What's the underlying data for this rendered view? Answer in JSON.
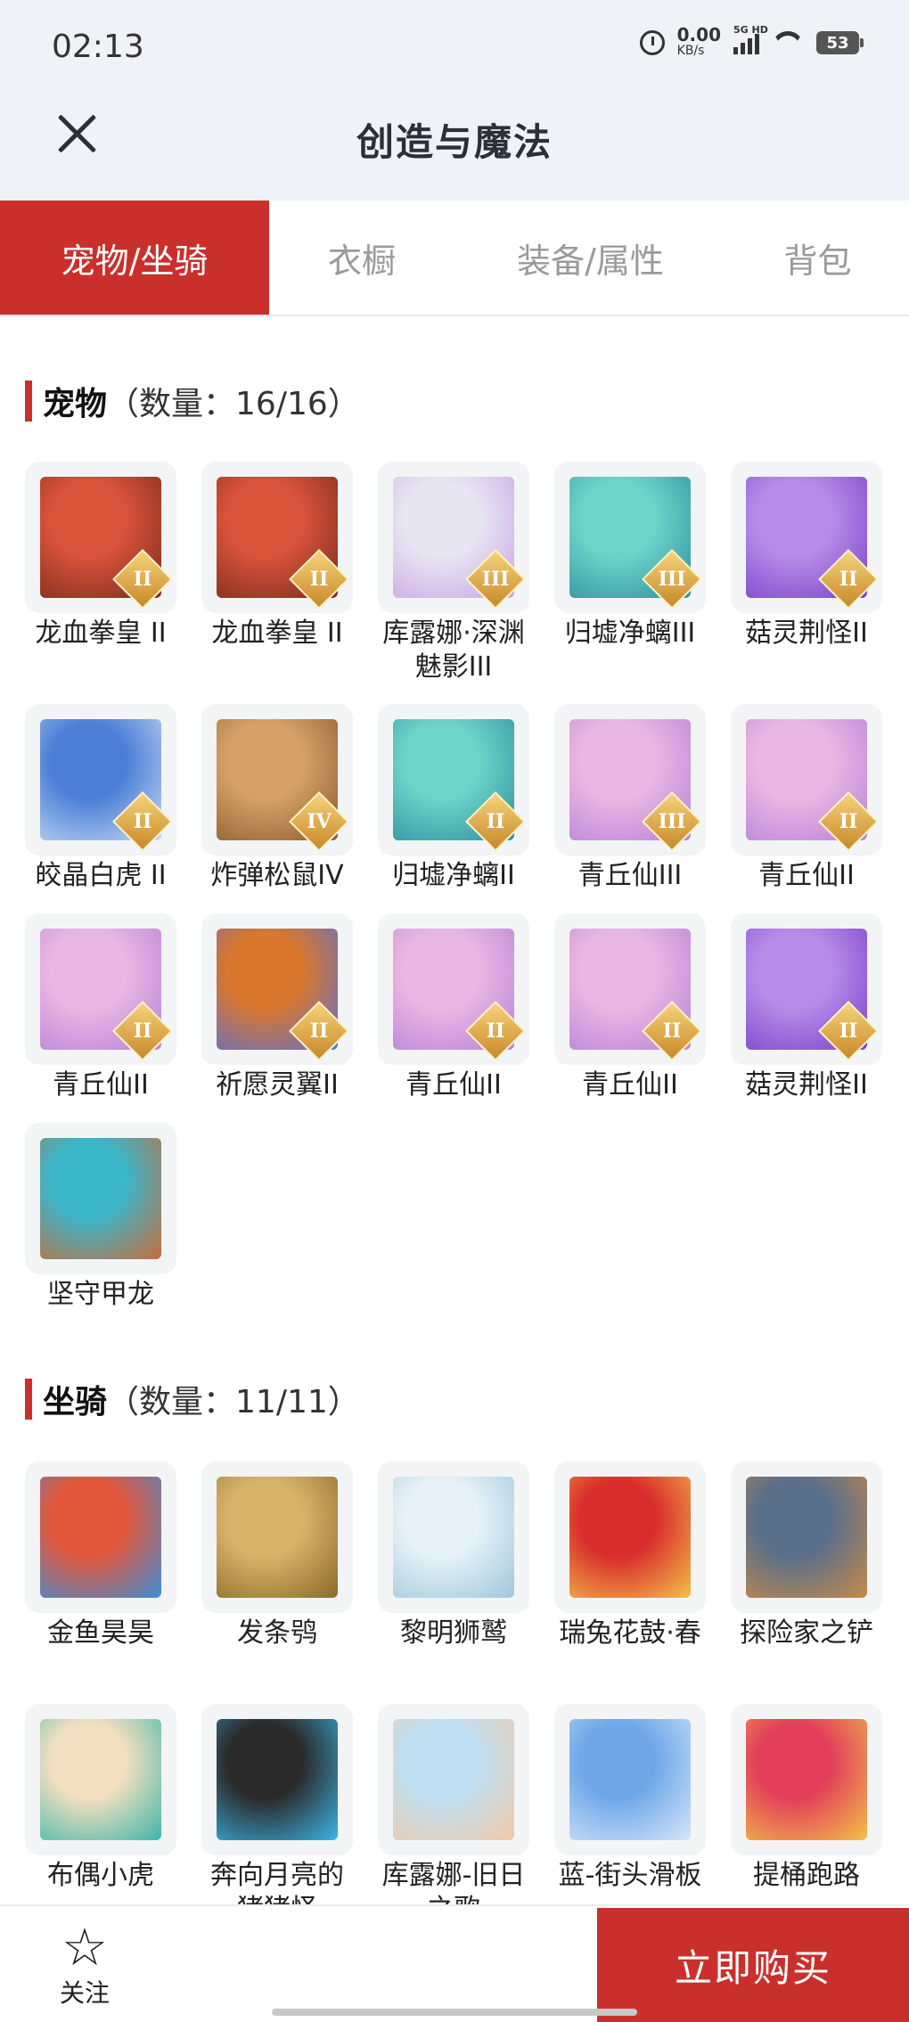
{
  "status": {
    "time": "02:13",
    "speed_value": "0.00",
    "speed_unit": "KB/s",
    "network": "5G HD",
    "battery": "53"
  },
  "header": {
    "title": "创造与魔法"
  },
  "tabs": [
    {
      "label": "宠物/坐骑",
      "active": true
    },
    {
      "label": "衣橱",
      "active": false
    },
    {
      "label": "装备/属性",
      "active": false
    },
    {
      "label": "背包",
      "active": false
    }
  ],
  "pets": {
    "title": "宠物",
    "count": "（数量：16/16）",
    "items": [
      {
        "name": "龙血拳皇 II",
        "rank": "II",
        "colors": [
          "#d9533a",
          "#7a2a1e"
        ],
        "icon": "dragon-fist-emperor-icon"
      },
      {
        "name": "龙血拳皇 II",
        "rank": "II",
        "colors": [
          "#d9533a",
          "#7a2a1e"
        ],
        "icon": "dragon-fist-emperor-icon"
      },
      {
        "name": "库露娜·深渊魅影III",
        "rank": "III",
        "colors": [
          "#e8e6f2",
          "#c8a3e6"
        ],
        "icon": "kuluna-abyss-icon"
      },
      {
        "name": "归墟净螭III",
        "rank": "III",
        "colors": [
          "#6fd3c9",
          "#2a8f9e"
        ],
        "icon": "guixu-dragon-icon"
      },
      {
        "name": "菇灵荆怪II",
        "rank": "II",
        "colors": [
          "#b78ce8",
          "#7a3fc9"
        ],
        "icon": "mushroom-sprite-icon"
      },
      {
        "name": "皎晶白虎 II",
        "rank": "II",
        "colors": [
          "#4b7fd6",
          "#c9dbf4"
        ],
        "icon": "white-tiger-icon"
      },
      {
        "name": "炸弹松鼠IV",
        "rank": "IV",
        "colors": [
          "#d6a26a",
          "#8a5a2a"
        ],
        "icon": "bomb-squirrel-icon"
      },
      {
        "name": "归墟净螭II",
        "rank": "II",
        "colors": [
          "#6fd3c9",
          "#2a8f9e"
        ],
        "icon": "guixu-dragon-icon"
      },
      {
        "name": "青丘仙III",
        "rank": "III",
        "colors": [
          "#eab7e4",
          "#b681d6"
        ],
        "icon": "qingqiu-fairy-icon"
      },
      {
        "name": "青丘仙II",
        "rank": "II",
        "colors": [
          "#eab7e4",
          "#b681d6"
        ],
        "icon": "qingqiu-fairy-icon"
      },
      {
        "name": "青丘仙II",
        "rank": "II",
        "colors": [
          "#eab7e4",
          "#b681d6"
        ],
        "icon": "qingqiu-fairy-icon"
      },
      {
        "name": "祈愿灵翼II",
        "rank": "II",
        "colors": [
          "#d9772e",
          "#5a6fd0"
        ],
        "icon": "wish-wing-icon"
      },
      {
        "name": "青丘仙II",
        "rank": "II",
        "colors": [
          "#eab7e4",
          "#b681d6"
        ],
        "icon": "qingqiu-fairy-icon"
      },
      {
        "name": "青丘仙II",
        "rank": "II",
        "colors": [
          "#eab7e4",
          "#b681d6"
        ],
        "icon": "qingqiu-fairy-icon"
      },
      {
        "name": "菇灵荆怪II",
        "rank": "II",
        "colors": [
          "#b78ce8",
          "#7a3fc9"
        ],
        "icon": "mushroom-sprite-icon"
      },
      {
        "name": "坚守甲龙",
        "rank": "",
        "colors": [
          "#3bb6c9",
          "#c96b3a"
        ],
        "icon": "armored-dragon-icon"
      }
    ]
  },
  "mounts": {
    "title": "坐骑",
    "count": "（数量：11/11）",
    "items": [
      {
        "name": "金鱼昊昊",
        "rank": "",
        "colors": [
          "#e2573c",
          "#3c8fd6"
        ],
        "icon": "goldfish-icon"
      },
      {
        "name": "发条鸮",
        "rank": "",
        "colors": [
          "#d8b46a",
          "#8a6a2a"
        ],
        "icon": "clockwork-owl-icon"
      },
      {
        "name": "黎明狮鹫",
        "rank": "",
        "colors": [
          "#e6f2f8",
          "#9fc7da"
        ],
        "icon": "dawn-griffin-icon"
      },
      {
        "name": "瑞兔花鼓·春",
        "rank": "",
        "colors": [
          "#d92c2c",
          "#f2c24a"
        ],
        "icon": "rabbit-drum-icon"
      },
      {
        "name": "探险家之铲",
        "rank": "",
        "colors": [
          "#5a6f8a",
          "#c88a4a"
        ],
        "icon": "explorer-shovel-icon"
      },
      {
        "name": "布偶小虎",
        "rank": "",
        "colors": [
          "#f2dfc0",
          "#3bb6a8"
        ],
        "icon": "doll-tiger-icon"
      },
      {
        "name": "奔向月亮的猪猪怪",
        "rank": "",
        "colors": [
          "#2a2a2a",
          "#3bb6e8"
        ],
        "icon": "moon-pig-icon"
      },
      {
        "name": "库露娜-旧日之歌",
        "rank": "",
        "colors": [
          "#bfe0f2",
          "#f2c9a8"
        ],
        "icon": "kuluna-song-icon"
      },
      {
        "name": "蓝-街头滑板",
        "rank": "",
        "colors": [
          "#6fa8e8",
          "#d6e6fa"
        ],
        "icon": "street-skateboard-icon"
      },
      {
        "name": "提桶跑路",
        "rank": "",
        "colors": [
          "#e2405a",
          "#f2c24a"
        ],
        "icon": "bucket-run-icon"
      }
    ]
  },
  "footer": {
    "follow_label": "关注",
    "buy_label": "立即购买"
  }
}
